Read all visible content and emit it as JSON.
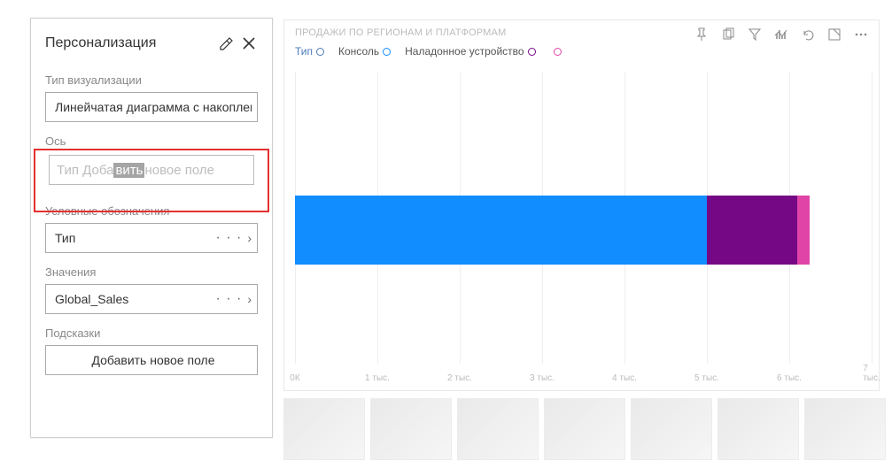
{
  "panel": {
    "title": "Персонализация",
    "viz_label": "Тип визуализации",
    "viz_value": "Линейчатая диаграмма с накоплением",
    "axis_label": "Ось",
    "axis_prefix": "Тип Доба",
    "axis_hl": "вить",
    "axis_suffix": " новое поле",
    "legend_label": "Условные обозначения",
    "legend_value": "Тип",
    "values_label": "Значения",
    "values_value": "Global_Sales",
    "hints_label": "Подсказки",
    "hints_value": "Добавить новое поле",
    "dots": "· · ·",
    "chev": "›"
  },
  "chart_title": "ПРОДАЖИ ПО РЕГИОНАМ И ПЛАТФОРМАМ",
  "legend_title": "Тип",
  "legend_items": [
    "Консоль",
    "Наладонное устройство",
    ""
  ],
  "xticks": [
    "0К",
    "1 тыс.",
    "2 тыс.",
    "3 тыс.",
    "4 тыс.",
    "5 тыс.",
    "6 тыс.",
    "7 тыс."
  ],
  "chart_data": {
    "type": "bar",
    "stacked": true,
    "orientation": "horizontal",
    "xlabel": "",
    "ylabel": "",
    "xlim": [
      0,
      7000
    ],
    "categories": [
      ""
    ],
    "series": [
      {
        "name": "Консоль",
        "values": [
          5000
        ],
        "color": "#118DFF"
      },
      {
        "name": "Наладонное устройство",
        "values": [
          1100
        ],
        "color": "#750985"
      },
      {
        "name": "",
        "values": [
          150
        ],
        "color": "#E044A7"
      }
    ],
    "title": "ПРОДАЖИ ПО РЕГИОНАМ И ПЛАТФОРМАМ"
  }
}
